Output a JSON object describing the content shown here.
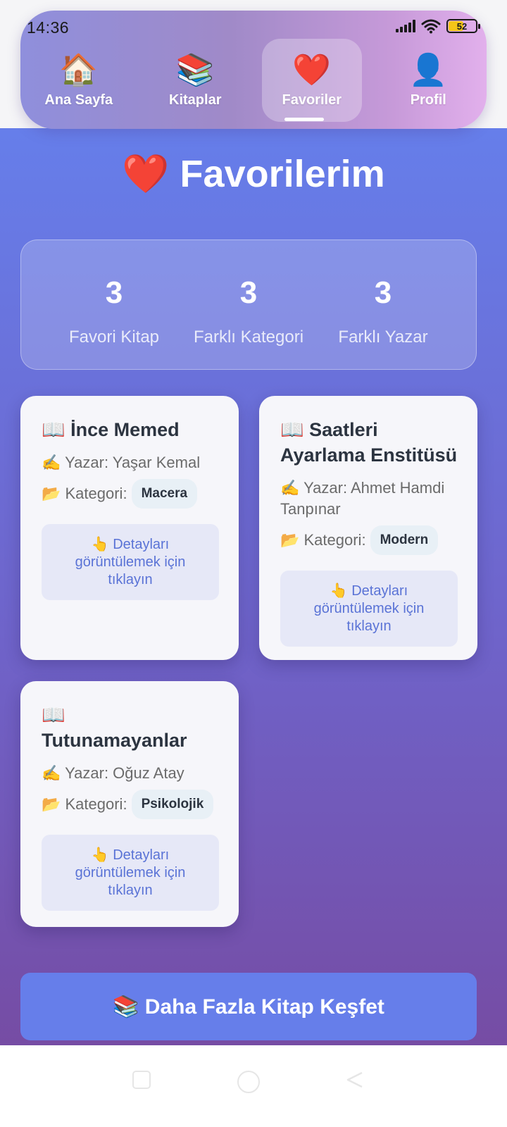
{
  "status": {
    "time": "14:36",
    "battery": "52"
  },
  "nav": {
    "items": [
      {
        "emoji": "🏠",
        "label": "Ana Sayfa"
      },
      {
        "emoji": "📚",
        "label": "Kitaplar"
      },
      {
        "emoji": "❤️",
        "label": "Favoriler"
      },
      {
        "emoji": "👤",
        "label": "Profil"
      }
    ],
    "active": "Favoriler"
  },
  "page": {
    "title": "❤️ Favorilerim"
  },
  "stats": [
    {
      "value": "3",
      "label": "Favori Kitap"
    },
    {
      "value": "3",
      "label": "Farklı Kategori"
    },
    {
      "value": "3",
      "label": "Farklı Yazar"
    }
  ],
  "books": [
    {
      "title": "📖 İnce Memed",
      "author": "✍️ Yazar: Yaşar Kemal",
      "category_label": "📂 Kategori:",
      "category": "Macera",
      "hint": "👆 Detayları görüntülemek için tıklayın"
    },
    {
      "title": "📖 Saatleri Ayarlama Enstitüsü",
      "author": "✍️ Yazar: Ahmet Hamdi Tanpınar",
      "category_label": "📂 Kategori:",
      "category": "Modern",
      "hint": "👆 Detayları görüntülemek için tıklayın"
    },
    {
      "title": "📖 Tutunamayanlar",
      "author": "✍️ Yazar: Oğuz Atay",
      "category_label": "📂 Kategori:",
      "category": "Psikolojik",
      "hint": "👆 Detayları görüntülemek için tıklayın"
    }
  ],
  "cta": {
    "label": "📚 Daha Fazla Kitap Keşfet"
  },
  "colors": {
    "primary": "#667eea",
    "secondary": "#764ba2",
    "hint_text": "#5a73d6",
    "title_text": "#2c3440"
  }
}
